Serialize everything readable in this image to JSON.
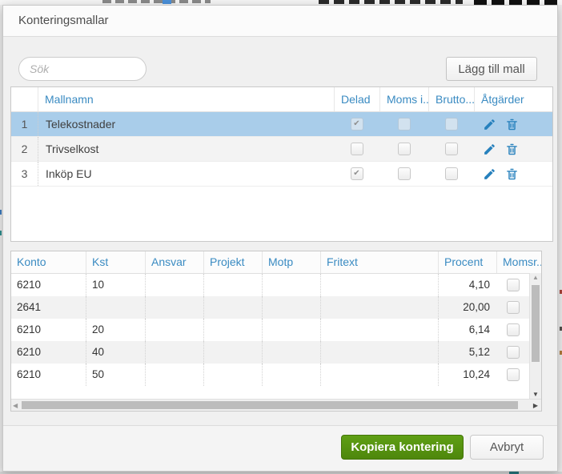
{
  "modal": {
    "title": "Konteringsmallar",
    "search_placeholder": "Sök",
    "add_button": "Lägg till mall",
    "templates_table": {
      "col_name": "Mallnamn",
      "col_shared": "Delad",
      "col_moms": "Moms i...",
      "col_brutto": "Brutto...",
      "col_actions": "Åtgärder",
      "rows": [
        {
          "num": "1",
          "name": "Telekostnader",
          "shared": "✔",
          "moms": "",
          "brutto": ""
        },
        {
          "num": "2",
          "name": "Trivselkost",
          "shared": "",
          "moms": "",
          "brutto": ""
        },
        {
          "num": "3",
          "name": "Inköp EU",
          "shared": "✔",
          "moms": "",
          "brutto": ""
        }
      ]
    },
    "details_table": {
      "col_konto": "Konto",
      "col_kst": "Kst",
      "col_ansvar": "Ansvar",
      "col_projekt": "Projekt",
      "col_motp": "Motp",
      "col_fritext": "Fritext",
      "col_procent": "Procent",
      "col_momsr": "Momsr...",
      "rows": [
        {
          "konto": "6210",
          "kst": "10",
          "ansvar": "",
          "projekt": "",
          "motp": "",
          "fritext": "",
          "procent": "4,10",
          "momsr": ""
        },
        {
          "konto": "2641",
          "kst": "",
          "ansvar": "",
          "projekt": "",
          "motp": "",
          "fritext": "",
          "procent": "20,00",
          "momsr": ""
        },
        {
          "konto": "6210",
          "kst": "20",
          "ansvar": "",
          "projekt": "",
          "motp": "",
          "fritext": "",
          "procent": "6,14",
          "momsr": ""
        },
        {
          "konto": "6210",
          "kst": "40",
          "ansvar": "",
          "projekt": "",
          "motp": "",
          "fritext": "",
          "procent": "5,12",
          "momsr": ""
        },
        {
          "konto": "6210",
          "kst": "50",
          "ansvar": "",
          "projekt": "",
          "motp": "",
          "fritext": "",
          "procent": "10,24",
          "momsr": ""
        }
      ]
    },
    "copy_button": "Kopiera kontering",
    "cancel_button": "Avbryt",
    "colors": {
      "accent_blue": "#3a8bc2",
      "selected_row_blue": "#a9cdea",
      "icon_blue": "#2781bd",
      "primary_green": "#569212"
    }
  }
}
